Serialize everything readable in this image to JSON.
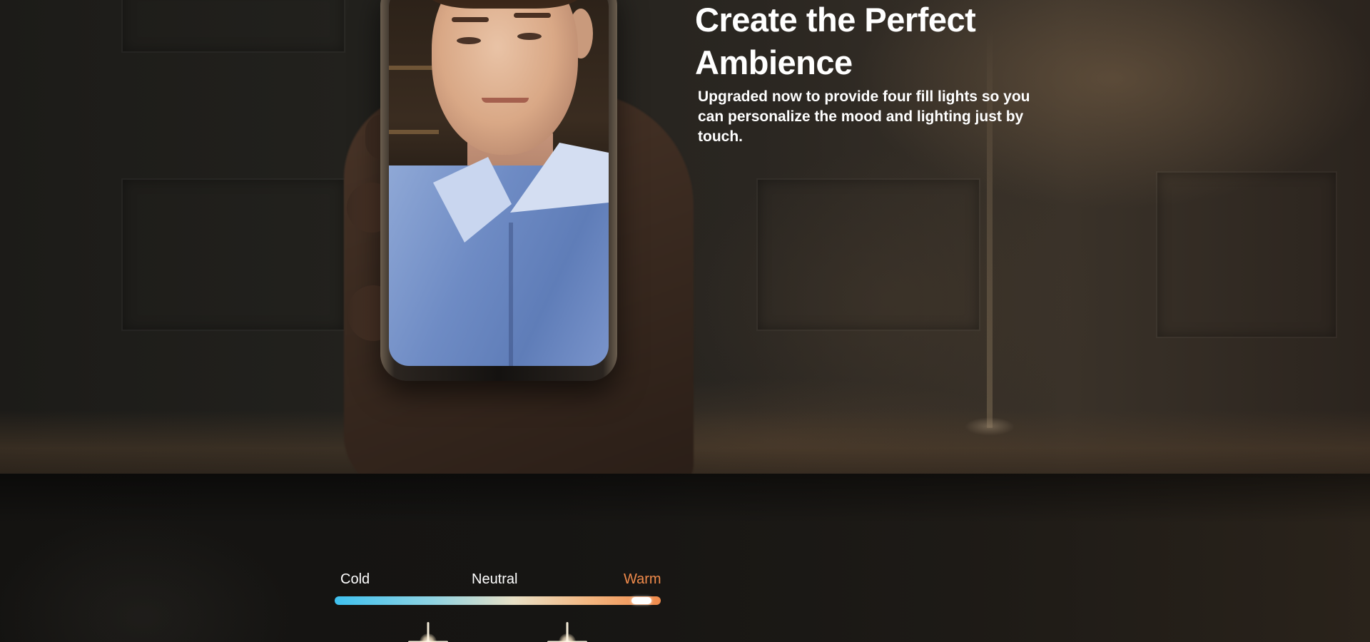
{
  "hero": {
    "headline": "Create the Perfect Ambience",
    "body": "Upgraded now to provide four fill lights so you can personalize the mood and lighting just by touch."
  },
  "color_temperature": {
    "labels": {
      "cold": "Cold",
      "neutral": "Neutral",
      "warm": "Warm"
    },
    "selected": "Warm",
    "slider_position": 0.94,
    "colors": {
      "cold": "#3fc1ef",
      "neutral": "#e8e0c6",
      "warm": "#f08a4b",
      "warm_label": "#f08a4b",
      "label": "#ffffff"
    }
  },
  "icons": [
    "fill-light-sparkle-icon",
    "fill-light-sparkle-icon"
  ]
}
